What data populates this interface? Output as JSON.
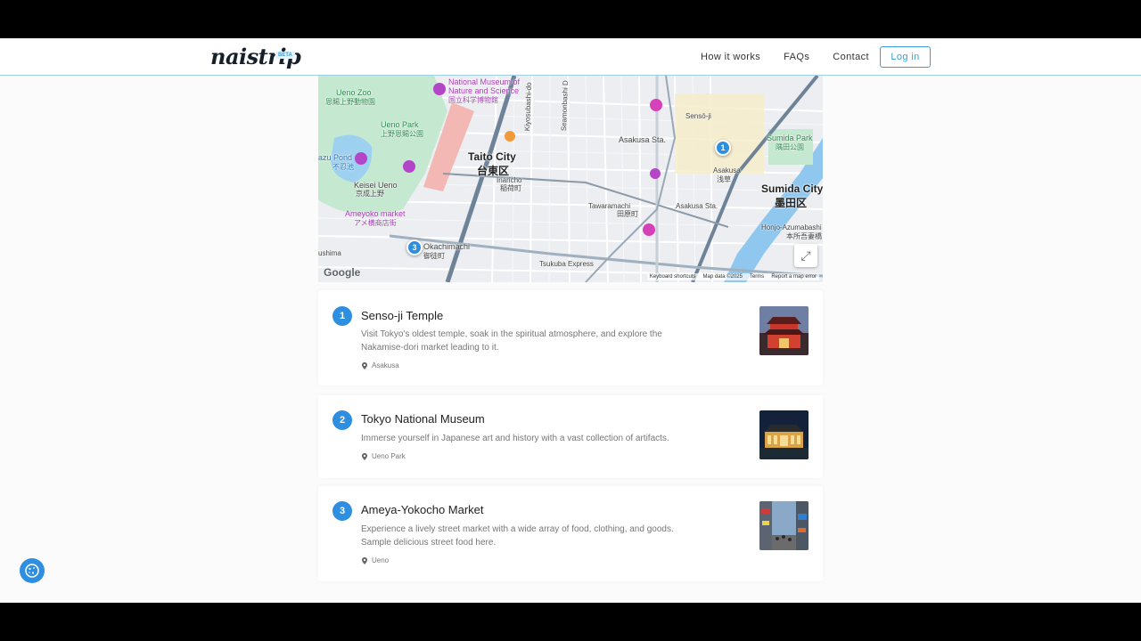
{
  "header": {
    "logo": "naistrip",
    "badge": "BETA",
    "nav": [
      "How it works",
      "FAQs",
      "Contact"
    ],
    "login": "Log in"
  },
  "map": {
    "labels": {
      "ueno_zoo": "Ueno Zoo",
      "ueno_zoo_jp": "恩賜上野動物園",
      "museum": "National Museum of",
      "museum2": "Nature and Science",
      "museum_jp": "国立科学博物館",
      "ueno_park": "Ueno Park",
      "ueno_park_jp": "上野恩賜公園",
      "pond": "azu Pond",
      "pond_jp": "不忍池",
      "keisei": "Keisei Ueno",
      "keisei_jp": "京成上野",
      "ameyoko": "Ameyoko market",
      "ameyoko_jp": "アメ横商店街",
      "taito": "Taito City",
      "taito_jp": "台東区",
      "inaricho": "Inaricho",
      "inaricho_jp": "稲荷町",
      "tawaramachi": "Tawaramachi",
      "tawaramachi_jp": "田原町",
      "asakusa_sta": "Asakusa Sta.",
      "asakusa": "Asakusa",
      "asakusa_jp": "浅草",
      "asakusa_sta2": "Asakusa Sta.",
      "sensoji": "Sensō-ji",
      "sumida_park": "Sumida Park",
      "sumida_park_jp": "隅田公園",
      "sumida_city": "Sumida City",
      "sumida_city_jp": "墨田区",
      "honjo": "Honjo-Azumabashi",
      "honjo_jp": "本所吾妻橋",
      "okachimachi": "Okachimachi",
      "okachimachi_jp": "御徒町",
      "tsukuba": "Tsukuba Express",
      "kiyosubashi": "Kiyosubashi-do",
      "semmonbashi": "Seamonbashi D",
      "yushima": "ushima"
    },
    "markers": [
      "1",
      "3"
    ],
    "google": "Google",
    "attribution": [
      "Keyboard shortcuts",
      "Map data ©2025",
      "Terms",
      "Report a map error"
    ]
  },
  "places": [
    {
      "num": "1",
      "title": "Senso-ji Temple",
      "desc": "Visit Tokyo's oldest temple, soak in the spiritual atmosphere, and explore the Nakamise-dori market leading to it.",
      "loc": "Asakusa"
    },
    {
      "num": "2",
      "title": "Tokyo National Museum",
      "desc": "Immerse yourself in Japanese art and history with a vast collection of artifacts.",
      "loc": "Ueno Park"
    },
    {
      "num": "3",
      "title": "Ameya-Yokocho Market",
      "desc": "Experience a lively street market with a wide array of food, clothing, and goods. Sample delicious street food here.",
      "loc": "Ueno"
    }
  ]
}
